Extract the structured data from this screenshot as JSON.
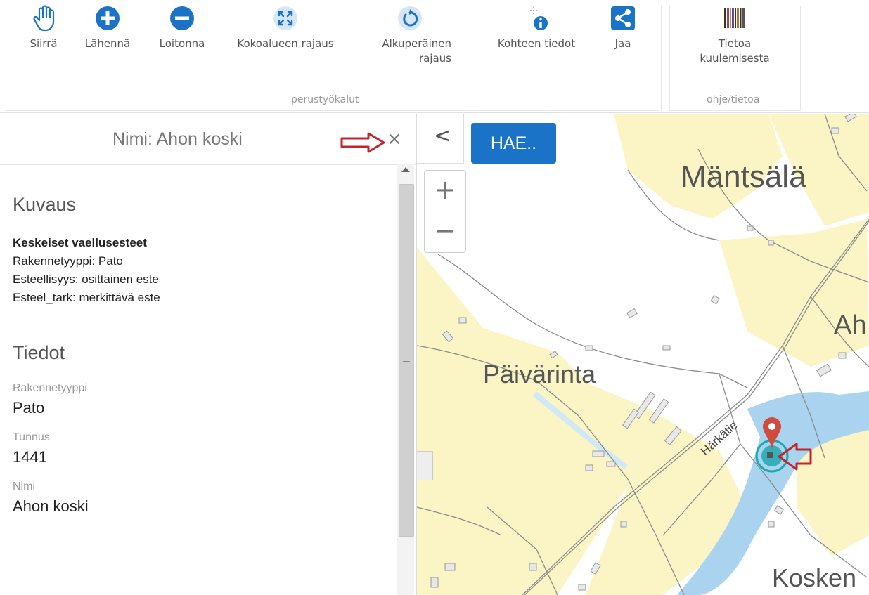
{
  "toolbar": {
    "tools": [
      {
        "label": "Siirrä",
        "icon": "hand-pan-icon"
      },
      {
        "label": "Lähennä",
        "icon": "zoom-in-icon"
      },
      {
        "label": "Loitonna",
        "icon": "zoom-out-icon"
      },
      {
        "label": "Kokoalueen rajaus",
        "icon": "full-extent-icon"
      },
      {
        "label_line1": "Alkuperäinen",
        "label_line2": "rajaus",
        "icon": "reset-extent-icon"
      },
      {
        "label": "Kohteen tiedot",
        "icon": "identify-info-icon"
      },
      {
        "label": "Jaa",
        "icon": "share-icon"
      },
      {
        "label_line1": "Tietoa",
        "label_line2": "kuulemisesta",
        "icon": "barcode-info-icon"
      }
    ],
    "groups": [
      "perustyökalut",
      "ohje/tietoa"
    ]
  },
  "panel": {
    "title": "Nimi: Ahon koski",
    "close_symbol": "×",
    "sections": {
      "kuvaus_title": "Kuvaus",
      "kuvaus_lines": [
        "Keskeiset vaellusesteet",
        "Rakennetyyppi: Pato",
        "Esteellisyys: osittainen este",
        "Esteel_tark: merkittävä este"
      ],
      "tiedot_title": "Tiedot",
      "fields": [
        {
          "label": "Rakennetyyppi",
          "value": "Pato"
        },
        {
          "label": "Tunnus",
          "value": "1441"
        },
        {
          "label": "Nimi",
          "value": "Ahon koski"
        }
      ]
    }
  },
  "map": {
    "collapse_symbol": "<",
    "search_label": "HAE..",
    "zoom_in": "+",
    "zoom_out": "−",
    "place_labels": [
      "Mäntsälä",
      "Päivärinta",
      "Ah",
      "Kosken"
    ],
    "road_label": "Härkätie",
    "colors": {
      "field": "#fbf5c6",
      "water": "#aad3ef",
      "road": "#8a8a8a",
      "marker": "#d24a3d",
      "target": "#17a8b0",
      "search_button": "#1a73c6",
      "annotation_arrow": "#c0262b"
    }
  }
}
